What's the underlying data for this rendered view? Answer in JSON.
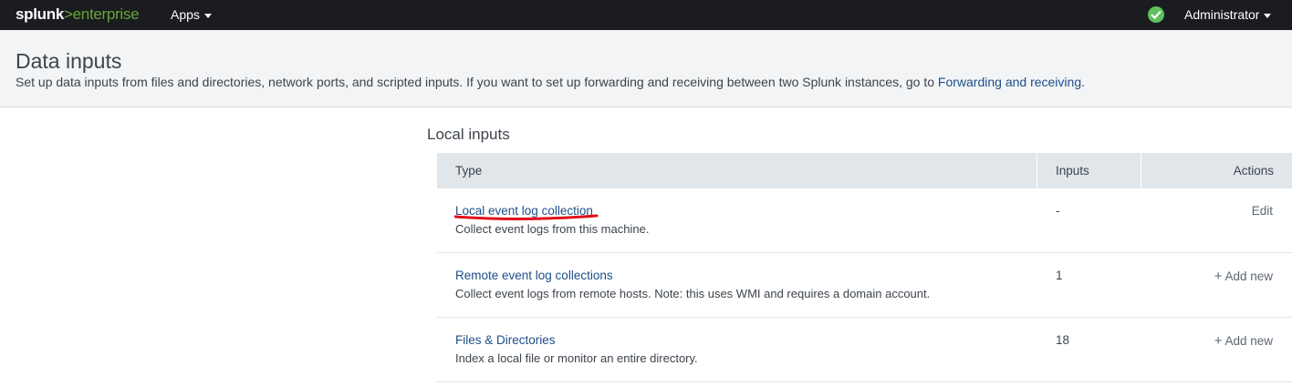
{
  "topbar": {
    "logo_brand": "splunk",
    "logo_sep": ">",
    "logo_product": "enterprise",
    "apps_label": "Apps",
    "status_icon": "check-circle-icon",
    "user_label": "Administrator",
    "status_color": "#5cc05c"
  },
  "header": {
    "title": "Data inputs",
    "description": "Set up data inputs from files and directories, network ports, and scripted inputs. If you want to set up forwarding and receiving between two Splunk instances, go to ",
    "link_text": "Forwarding and receiving",
    "description_end": "."
  },
  "section": {
    "title": "Local inputs"
  },
  "table": {
    "columns": [
      "Type",
      "Inputs",
      "Actions"
    ],
    "rows": [
      {
        "type": "Local event log collection",
        "description": "Collect event logs from this machine.",
        "inputs": "-",
        "action": "Edit",
        "action_icon": ""
      },
      {
        "type": "Remote event log collections",
        "description": "Collect event logs from remote hosts. Note: this uses WMI and requires a domain account.",
        "inputs": "1",
        "action": "Add new",
        "action_icon": "+"
      },
      {
        "type": "Files & Directories",
        "description": "Index a local file or monitor an entire directory.",
        "inputs": "18",
        "action": "Add new",
        "action_icon": "+"
      }
    ]
  },
  "annotation_color": "#e0101a"
}
